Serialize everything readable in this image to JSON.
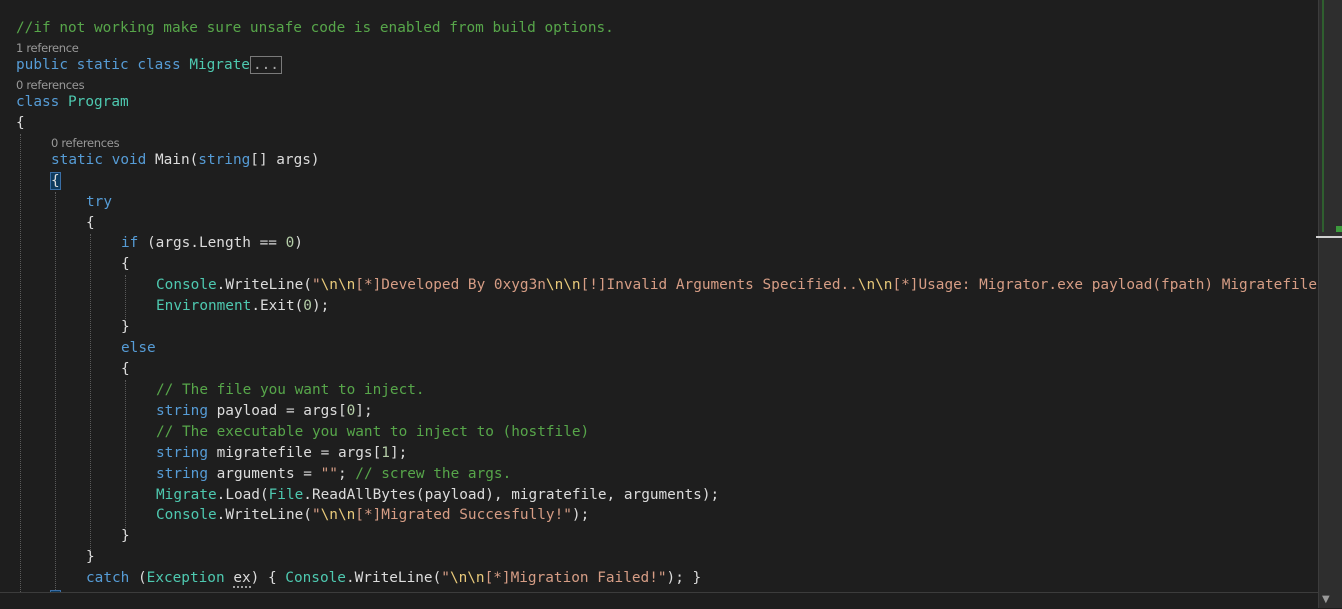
{
  "editor": {
    "language": "C#",
    "theme_colors": {
      "background": "#1e1e1e",
      "keyword": "#569cd6",
      "control_keyword": "#d8a0df",
      "type": "#4ec9b0",
      "string": "#d69d85",
      "escape": "#e8c97a",
      "comment": "#57a64a",
      "number": "#b5cea8",
      "text": "#dcdcdc",
      "codelens": "#999999"
    },
    "code": {
      "top_comment": "//if not working make sure unsafe code is enabled from build options.",
      "ref_migrate": "1 reference",
      "ref_program": "0 references",
      "ref_main": "0 references",
      "fold_placeholder": "...",
      "kw_public": "public",
      "kw_static": "static",
      "kw_class": "class",
      "kw_void": "void",
      "kw_string": "string",
      "kw_if": "if",
      "kw_else": "else",
      "kw_try": "try",
      "kw_catch": "catch",
      "class_migrate": "Migrate",
      "class_program": "Program",
      "type_console": "Console",
      "type_environment": "Environment",
      "type_file": "File",
      "type_exception": "Exception",
      "brace_open": "{",
      "brace_close": "}",
      "main_sig_a": " Main(",
      "main_sig_b": "[] args)",
      "if_cond_a": " (args.Length == ",
      "num_0": "0",
      "num_1": "1",
      "if_cond_b": ")",
      "wl_open": ".WriteLine(",
      "wl_close": ");",
      "dq": "\"",
      "esc_nn": "\\n\\n",
      "str_usage_1": "[*]Developed By 0xyg3n",
      "str_usage_2": "[!]Invalid Arguments Specified..",
      "str_usage_3": "[*]Usage: Migrator.exe payload(fpath) Migratefile(fpath)",
      "exit_a": ".Exit(",
      "exit_b": ");",
      "comment_inject": "// The file you want to inject.",
      "payload_decl_a": " payload = args[",
      "idx_close": "];",
      "comment_host": "// The executable you want to inject to (hostfile)",
      "migratefile_decl_a": " migratefile = args[",
      "arguments_decl_a": " arguments = ",
      "empty_str": "\"\"",
      "semicolon_space": "; ",
      "comment_args": "// screw the args.",
      "load_call_a": ".Load(",
      "read_all": ".ReadAllBytes(payload), migratefile, arguments);",
      "str_migrated": "[*]Migrated Succesfully!",
      "catch_a": " (",
      "catch_var": "ex",
      "catch_b": ") { ",
      "str_failed": "[*]Migration Failed!",
      "catch_end": "); }"
    }
  }
}
